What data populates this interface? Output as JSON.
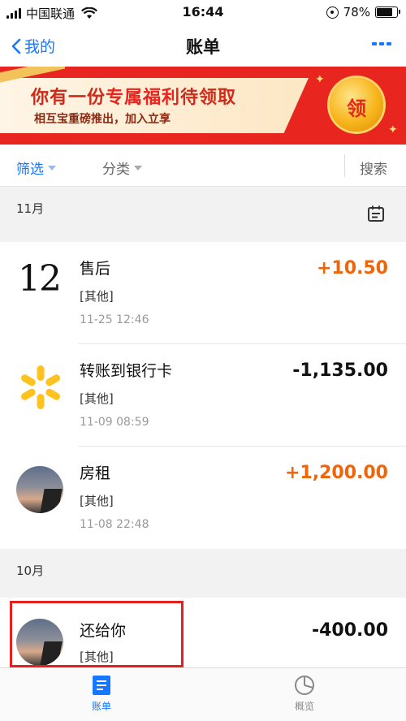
{
  "status_bar": {
    "carrier": "中国联通",
    "time": "16:44",
    "battery": "78%",
    "battery_level": 0.78
  },
  "nav": {
    "back_label": "我的",
    "title": "账单"
  },
  "banner": {
    "title_prefix": "你有一份",
    "title_highlight": "专属福利",
    "title_suffix": "待领取",
    "subtitle": "相互宝重磅推出，加入立享",
    "coin_label": "领"
  },
  "filter": {
    "filter_label": "筛选",
    "category_label": "分类",
    "search_label": "搜索"
  },
  "months": [
    {
      "label": "11月"
    },
    {
      "label": "10月"
    }
  ],
  "transactions": [
    {
      "icon": "date-12",
      "date_num": "12",
      "title": "售后",
      "category": "[其他]",
      "time": "11-25  12:46",
      "amount": "+10.50"
    },
    {
      "icon": "walmart-spark-icon",
      "title": "转账到银行卡",
      "category": "[其他]",
      "time": "11-09  08:59",
      "amount": "-1,135.00"
    },
    {
      "icon": "avatar",
      "title": "房租",
      "category": "[其他]",
      "time": "11-08  22:48",
      "amount": "+1,200.00"
    },
    {
      "icon": "avatar",
      "title": "还给你",
      "category": "[其他]",
      "amount": "-400.00"
    }
  ],
  "tabbar": {
    "bill_label": "账单",
    "overview_label": "概览"
  },
  "colors": {
    "accent": "#1677ff",
    "income": "#f0640a",
    "banner_red": "#e8251e",
    "highlight_box": "#e81f1f",
    "walmart_yellow": "#ffc220"
  }
}
